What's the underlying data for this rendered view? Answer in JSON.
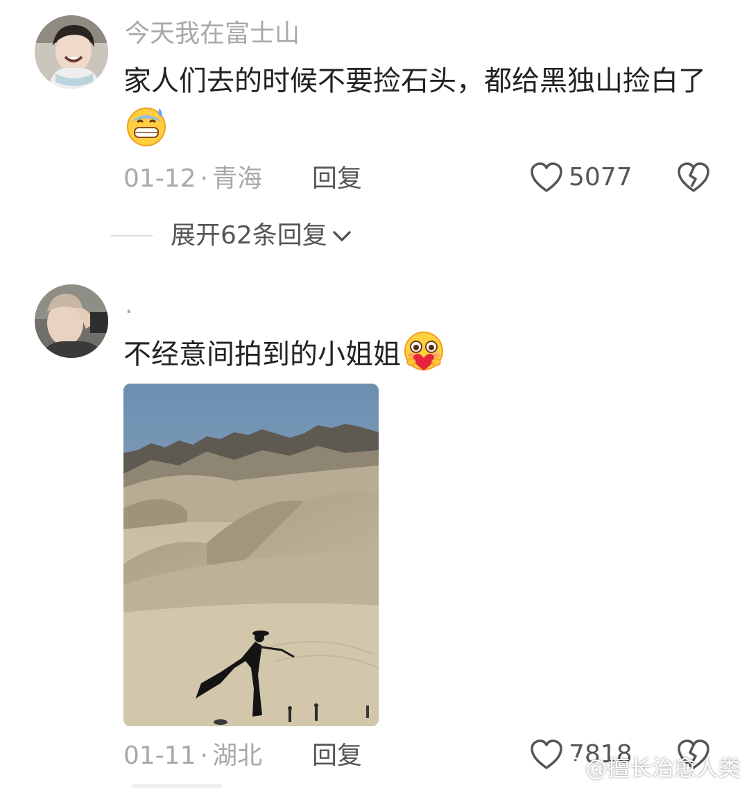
{
  "comments": [
    {
      "username": "今天我在富士山",
      "text": "家人们去的时候不要捡石头，都给黑独山捡白了",
      "emoji_icon": "anxious-grin-emoji",
      "date": "01-12",
      "separator": "·",
      "location": "青海",
      "reply_label": "回复",
      "like_count": "5077",
      "expand_replies_label": "展开62条回复"
    },
    {
      "username": "·",
      "text": "不经意间拍到的小姐姐",
      "emoji_icon": "heart-hug-emoji",
      "date": "01-11",
      "separator": "·",
      "location": "湖北",
      "reply_label": "回复",
      "like_count": "7818"
    }
  ],
  "watermark": {
    "text": "@擅长治愈人类",
    "icon": "weibo-logo-icon"
  },
  "colors": {
    "background": "#ffffff",
    "meta_gray": "#a8a8a8",
    "text_dark": "#222222",
    "action_gray": "#555555"
  }
}
